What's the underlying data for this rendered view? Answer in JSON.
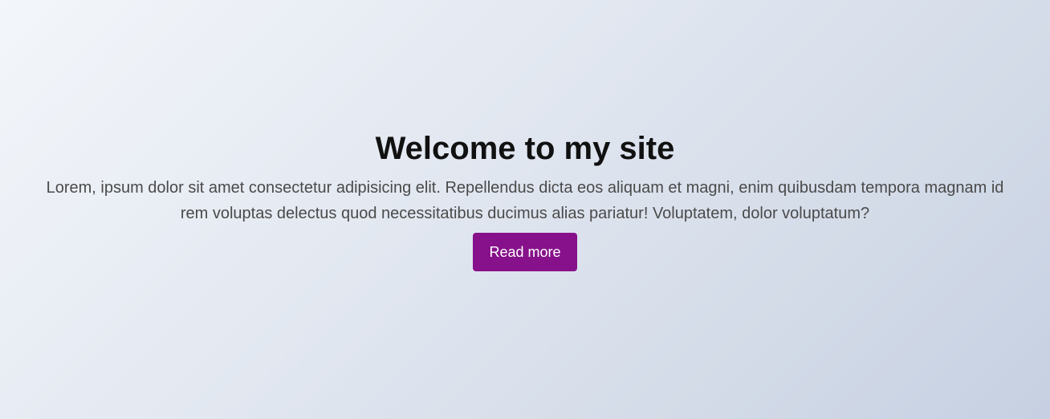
{
  "hero": {
    "title": "Welcome to my site",
    "description": "Lorem, ipsum dolor sit amet consectetur adipisicing elit. Repellendus dicta eos aliquam et magni, enim quibusdam tempora magnam id rem voluptas delectus quod necessitatibus ducimus alias pariatur! Voluptatem, dolor voluptatum?",
    "button_label": "Read more"
  },
  "colors": {
    "accent": "#86118a",
    "heading": "#111111",
    "body_text": "#4a4a4a",
    "background_start": "#f3f6fa",
    "background_end": "#c6d0e2"
  }
}
